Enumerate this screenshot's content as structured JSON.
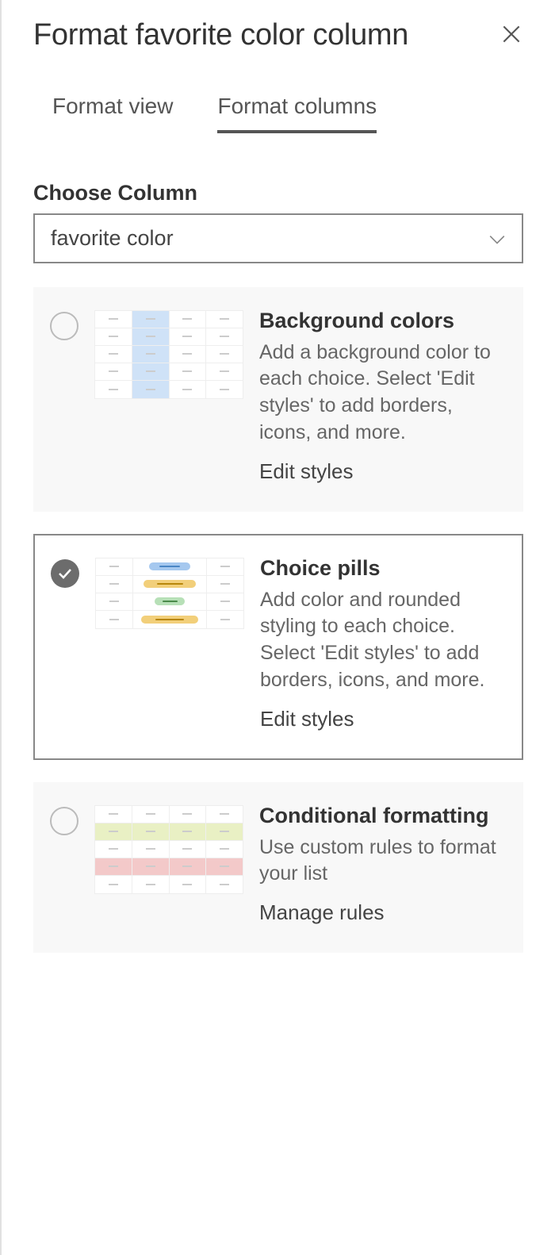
{
  "header": {
    "title": "Format favorite color column"
  },
  "tabs": {
    "view": "Format view",
    "columns": "Format columns"
  },
  "choose_column": {
    "label": "Choose Column",
    "value": "favorite color"
  },
  "options": {
    "background": {
      "title": "Background colors",
      "desc": "Add a background color to each choice. Select 'Edit styles' to add borders, icons, and more.",
      "link": "Edit styles",
      "selected": false
    },
    "pills": {
      "title": "Choice pills",
      "desc": "Add color and rounded styling to each choice. Select 'Edit styles' to add borders, icons, and more.",
      "link": "Edit styles",
      "selected": true
    },
    "conditional": {
      "title": "Conditional formatting",
      "desc": "Use custom rules to format your list",
      "link": "Manage rules",
      "selected": false
    }
  }
}
